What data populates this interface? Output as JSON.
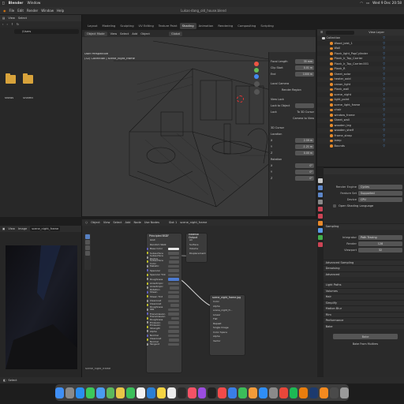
{
  "macos": {
    "app": "Blender",
    "menus": [
      "Window"
    ],
    "clock": "Wed 9 Dec 20:58"
  },
  "blender": {
    "menus": [
      "File",
      "Edit",
      "Render",
      "Window",
      "Help"
    ],
    "file_title": "Lukas-dang_old_house.blend",
    "workspace_tabs": [
      "Layout",
      "Modeling",
      "Sculpting",
      "UV Editing",
      "Texture Paint",
      "Shading",
      "Animation",
      "Rendering",
      "Compositing",
      "Scripting"
    ],
    "active_tab": "Shading"
  },
  "file_browser": {
    "header": [
      "View",
      "Select"
    ],
    "path": "/Users",
    "folders": [
      {
        "name": "shows",
        "color": "#d8a33b"
      },
      {
        "name": "Shared",
        "color": "#d8a33b"
      }
    ]
  },
  "viewport": {
    "header": [
      "Object Mode",
      "View",
      "Select",
      "Add",
      "Object"
    ],
    "overlay_lines": [
      "User Perspective",
      "(32) Collection | scene_night_frame"
    ],
    "shading_mode": "Global"
  },
  "n_panel": {
    "rows": [
      {
        "label": "Focal Length",
        "value": "35 mm"
      },
      {
        "label": "Clip Start",
        "value": "0.01 m"
      },
      {
        "label": "End",
        "value": "1000 m"
      },
      {
        "label": "Local Camera",
        "value": ""
      },
      {
        "label": "Render Region",
        "value": ""
      },
      {
        "label": "View Lock",
        "value": ""
      },
      {
        "label": "Lock to Object",
        "value": ""
      },
      {
        "label": "Lock",
        "value": "To 3D Cursor"
      },
      {
        "label": "",
        "value": "Camera to View"
      },
      {
        "label": "3D Cursor",
        "value": ""
      },
      {
        "label": "Location",
        "value": ""
      },
      {
        "label": "X",
        "value": "2.59 m"
      },
      {
        "label": "Y",
        "value": "-1.21 m"
      },
      {
        "label": "Z",
        "value": "0.00 m"
      },
      {
        "label": "Rotation",
        "value": ""
      },
      {
        "label": "X",
        "value": "0°"
      },
      {
        "label": "Y",
        "value": "0°"
      },
      {
        "label": "Z",
        "value": "0°"
      }
    ]
  },
  "outliner": {
    "header": "View Layer",
    "items": [
      "Collection",
      "Wood_joist_1",
      "Wall",
      "Plank_light_PopCylinder",
      "Plank_lr_Top_Carrier",
      "Plank_lr_Top_Carrier.001",
      "Plank_R",
      "Sheet_solar",
      "heater_oxid",
      "canon_light",
      "Plank_wall",
      "scene_night",
      "light_point",
      "scene_light_frame",
      "chair",
      "window_frame",
      "Sheet_wall",
      "wooden_leg",
      "wooden_shelf",
      "Frame_strap",
      "lamp",
      "Bounds"
    ]
  },
  "properties": {
    "rows": [
      {
        "label": "Render Engine",
        "value": "Cycles"
      },
      {
        "label": "Feature Set",
        "value": "Supported"
      },
      {
        "label": "Device",
        "value": "CPU"
      }
    ],
    "checkbox": "Open Shading Language",
    "sampling_section": "Sampling",
    "integrator_rows": [
      {
        "label": "Integrator",
        "value": "Path Tracing"
      },
      {
        "label": "Render",
        "value": "128"
      },
      {
        "label": "Viewport",
        "value": "32"
      }
    ],
    "sections": [
      "Advanced Sampling",
      "Denoising",
      "Advanced",
      "Light Paths",
      "Volumes",
      "Hair",
      "Simplify",
      "Motion Blur",
      "Film",
      "Performance",
      "Bake"
    ],
    "bake_button": "Bake",
    "bake_extra": "Bake From Multires"
  },
  "image_editor": {
    "header": [
      "View",
      "View",
      "Image"
    ],
    "image_name": "scene_night_frame"
  },
  "node_editor": {
    "header": [
      "Object",
      "View",
      "Select",
      "Add",
      "Node",
      "Use Nodes",
      "Slot 1",
      "scene_night_frame"
    ],
    "nodes": [
      {
        "title": "Principled BSDF",
        "color": "#3e6a43",
        "rows": [
          "GGX",
          "Random Walk",
          "Base Color",
          "Subsurface",
          "Subsurface Radius",
          "Subsurface Color",
          "Metallic",
          "Specular",
          "Specular Tint",
          "Roughness",
          "Anisotropic",
          "Anisotropic Rotation",
          "Sheen",
          "Sheen Tint",
          "Clearcoat",
          "Clearcoat Roughness",
          "IOR",
          "Transmission",
          "Transmission Roughness",
          "Emission",
          "Emission Strength",
          "Alpha",
          "Normal",
          "Clearcoat Normal",
          "Tangent"
        ]
      },
      {
        "title": "Material Output",
        "color": "#7b2d2d",
        "rows": [
          "All",
          "Surface",
          "Volume",
          "Displacement"
        ]
      },
      {
        "title": "scene_night_frame.jpg",
        "color": "#b8602e",
        "rows": [
          "Color",
          "Alpha",
          "scene_night_fr...",
          "Linear",
          "Flat",
          "Repeat",
          "Single Image",
          "Color Space",
          "Alpha",
          "Vector"
        ]
      }
    ],
    "material_label": "scene_night_frame"
  },
  "status_bar": {
    "left": "Select"
  },
  "dock": {
    "icons": [
      {
        "name": "finder-icon",
        "color": "#3f8ff5"
      },
      {
        "name": "launchpad-icon",
        "color": "#8a8a8a"
      },
      {
        "name": "safari-icon",
        "color": "#2a8ef0"
      },
      {
        "name": "messages-icon",
        "color": "#3cc85a"
      },
      {
        "name": "mail-icon",
        "color": "#4a9bf0"
      },
      {
        "name": "maps-icon",
        "color": "#5cb85c"
      },
      {
        "name": "photos-icon",
        "color": "#e8c547"
      },
      {
        "name": "facetime-icon",
        "color": "#3bbf5a"
      },
      {
        "name": "calendar-icon",
        "color": "#f2f2f2"
      },
      {
        "name": "vscode-icon",
        "color": "#2b7fd4"
      },
      {
        "name": "notes-icon",
        "color": "#f5d442"
      },
      {
        "name": "reminders-icon",
        "color": "#ececec"
      },
      {
        "name": "terminal-icon",
        "color": "#2b2b2b"
      },
      {
        "name": "music-icon",
        "color": "#f55266"
      },
      {
        "name": "podcasts-icon",
        "color": "#9b4de0"
      },
      {
        "name": "tv-icon",
        "color": "#222222"
      },
      {
        "name": "news-icon",
        "color": "#f24a4a"
      },
      {
        "name": "keynote-icon",
        "color": "#3a7ee8"
      },
      {
        "name": "numbers-icon",
        "color": "#3bbd5a"
      },
      {
        "name": "pages-icon",
        "color": "#f29b3a"
      },
      {
        "name": "appstore-icon",
        "color": "#2f8ef5"
      },
      {
        "name": "preferences-icon",
        "color": "#8a8a8a"
      },
      {
        "name": "chrome-icon",
        "color": "#e8473a"
      },
      {
        "name": "spotify-icon",
        "color": "#1db954"
      },
      {
        "name": "blender-icon",
        "color": "#e87d0d"
      },
      {
        "name": "photoshop-icon",
        "color": "#1c3a6e"
      },
      {
        "name": "vlc-icon",
        "color": "#f58a1f"
      },
      {
        "name": "files-icon",
        "color": "#4a4a4a"
      },
      {
        "name": "trash-icon",
        "color": "#9a9a9a"
      }
    ]
  }
}
